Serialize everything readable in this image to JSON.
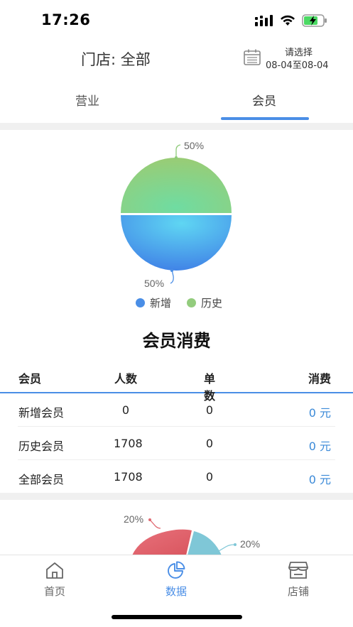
{
  "status_bar": {
    "time": "17:26"
  },
  "header": {
    "store_title": "门店: 全部",
    "date_prompt": "请选择",
    "date_range": "08-04至08-04"
  },
  "tabs": [
    {
      "label": "营业",
      "active": false
    },
    {
      "label": "会员",
      "active": true
    }
  ],
  "member_pie": {
    "chart_data": {
      "type": "pie",
      "slices": [
        {
          "name": "新增",
          "value": 50,
          "label": "50%",
          "color": "#4a90e2"
        },
        {
          "name": "历史",
          "value": 50,
          "label": "50%",
          "color": "#8fd07a"
        }
      ],
      "legend_placement": "bottom"
    },
    "top_label": "50%",
    "bottom_label": "50%",
    "legend": [
      {
        "name": "新增",
        "color": "#4a8ee6"
      },
      {
        "name": "历史",
        "color": "#93cc7d"
      }
    ]
  },
  "member_consumption": {
    "title": "会员消费",
    "columns": [
      "会员",
      "人数",
      "单数",
      "消费"
    ],
    "rows": [
      {
        "type": "新增会员",
        "count": "0",
        "orders": "0",
        "spend": "0 元"
      },
      {
        "type": "历史会员",
        "count": "1708",
        "orders": "0",
        "spend": "0 元"
      },
      {
        "type": "全部会员",
        "count": "1708",
        "orders": "0",
        "spend": "0 元"
      }
    ]
  },
  "second_pie": {
    "labels": [
      "20%",
      "20%"
    ]
  },
  "bottom_nav": [
    {
      "label": "首页",
      "icon": "home-icon",
      "active": false
    },
    {
      "label": "数据",
      "icon": "pie-chart-icon",
      "active": true
    },
    {
      "label": "店铺",
      "icon": "store-icon",
      "active": false
    }
  ],
  "colors": {
    "accent": "#4a8ee6",
    "money": "#3b8ad8"
  }
}
